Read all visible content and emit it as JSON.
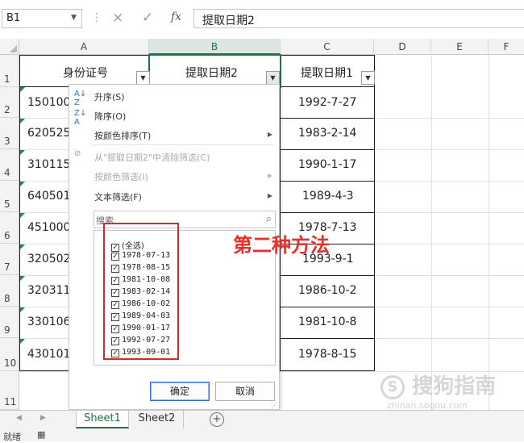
{
  "formula_bar": {
    "name_box": "B1",
    "formula": "提取日期2",
    "cancel_icon": "×",
    "confirm_icon": "✓",
    "fx_label": "fx"
  },
  "columns": [
    "A",
    "B",
    "C",
    "D",
    "E",
    "F"
  ],
  "rows": [
    "1",
    "2",
    "3",
    "4",
    "5",
    "6",
    "7",
    "8",
    "9",
    "10",
    "11"
  ],
  "headers": {
    "a": "身份证号",
    "b": "提取日期2",
    "c": "提取日期1"
  },
  "col_a_values": [
    "150100",
    "620525",
    "310115",
    "640501",
    "451000",
    "320502",
    "320311",
    "330106",
    "430101"
  ],
  "col_c_values": [
    "1992-7-27",
    "1983-2-14",
    "1990-1-17",
    "1989-4-3",
    "1978-7-13",
    "1993-9-1",
    "1986-10-2",
    "1981-10-8",
    "1978-8-15"
  ],
  "filter_menu": {
    "sort_asc": "升序(S)",
    "sort_desc": "降序(O)",
    "sort_by_color": "按颜色排序(T)",
    "clear_filter": "从\"提取日期2\"中清除筛选(C)",
    "filter_by_color": "按颜色筛选(I)",
    "text_filter": "文本筛选(F)",
    "search_placeholder": "搜索",
    "select_all": "(全选)",
    "items": [
      "1978-07-13",
      "1978-08-15",
      "1981-10-08",
      "1983-02-14",
      "1986-10-02",
      "1989-04-03",
      "1990-01-17",
      "1992-07-27",
      "1993-09-01"
    ],
    "ok_label": "确定",
    "cancel_label": "取消"
  },
  "annotation": "第二种方法",
  "sheet_tabs": [
    "Sheet1",
    "Sheet2"
  ],
  "add_sheet": "+",
  "status": "就绪",
  "watermark": "搜狗指南",
  "watermark_url": "zhinan.sogou.com",
  "colors": {
    "excel_green": "#217346",
    "annotation_red": "#e8302a",
    "highlight_box": "#d42a2a"
  }
}
